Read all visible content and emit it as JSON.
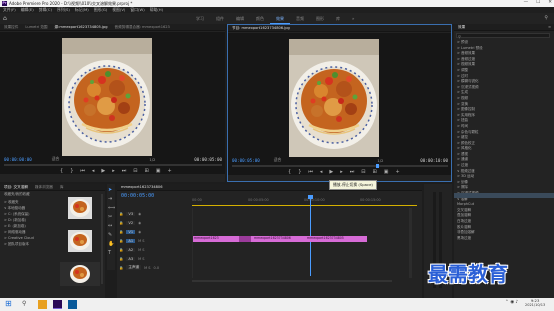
{
  "window": {
    "title": "Adobe Premiere Pro 2020 - D:\\\\视频\\\\010\\\\交叉溶解效果.prproj *",
    "minimize": "—",
    "maximize": "☐",
    "close": "✕"
  },
  "menu": [
    "文件(F)",
    "编辑(E)",
    "剪辑(C)",
    "序列(S)",
    "标记(M)",
    "图形(G)",
    "视图(V)",
    "窗口(W)",
    "帮助(H)"
  ],
  "workspaces": {
    "items": [
      "学习",
      "组件",
      "编辑",
      "颜色",
      "效果",
      "音频",
      "图形",
      "库"
    ],
    "active_index": 4,
    "overflow": "»"
  },
  "source_panel": {
    "tabs": [
      "效果控件",
      "Lumetri 范围",
      "源:mmexport1623734805.jpg",
      "音频剪辑混合器: mmexport1623"
    ],
    "active_tab_index": 2,
    "timecode_left": "00:00:00:00",
    "fit": "适合",
    "ratio": "1/2",
    "timecode_right": "00:00:05:00"
  },
  "program_panel": {
    "tabs": [
      "节目: mmexport1623734806.jpg"
    ],
    "timecode_left": "00:00:05:00",
    "fit": "适合",
    "ratio": "1/2",
    "timecode_right": "00:00:10:00"
  },
  "project_panel": {
    "tabs": [
      "项目: 交叉溶解",
      "媒体浏览器",
      "库",
      "信息",
      "效果"
    ],
    "active_tab_index": 0,
    "breadcrumb": "收藏夹/我的收藏",
    "tree": [
      "> 收藏夹",
      "∨ 本地驱动器",
      "> C: (系统保留)",
      "> D: (新加卷)",
      "> E: (新加卷)",
      "> 网络驱动器",
      "> Creative Cloud",
      "> 团队项目版本"
    ]
  },
  "timeline": {
    "tab": "mmexport1623734806",
    "timecode": "00:00:05:00",
    "tooltip": "播放-停止切换 (Space)",
    "ruler_labels": [
      "00:00",
      "00:00:05:00",
      "00:00:10:00",
      "00:00:15:00"
    ],
    "tracks": [
      "V3",
      "V2",
      "V1",
      "A1",
      "A2",
      "A3",
      "主声道"
    ],
    "master_value": "0.0",
    "clips": [
      {
        "label": "mmexport1623",
        "color": "#d66bd6"
      },
      {
        "label": "mmexport1623734806",
        "color": "#d66bd6"
      },
      {
        "label": "mmexport1623734805",
        "color": "#d66bd6"
      }
    ]
  },
  "effects_panel": {
    "title": "效果",
    "items": [
      "> 预设",
      "> Lumetri 预设",
      "> 音频效果",
      "> 音频过渡",
      "> 视频效果",
      "  > 调整",
      "  > 过时",
      "  > 模糊与锐化",
      "  > 沉浸式视频",
      "  > 生成",
      "  > 视频",
      "  > 变换",
      "  > 图像控制",
      "  > 实用程序",
      "  > 扭曲",
      "  > 时间",
      "  > 杂色与颗粒",
      "  > 键控",
      "  > 颜色校正",
      "  > 风格化",
      "  > 透视",
      "  > 通道",
      "  > 过渡",
      "∨ 视频过渡",
      "  > 3D 运动",
      "  > 划像",
      "  > 擦除",
      "  > 沉浸式视频",
      "  ∨ 溶解",
      "    MorphCut",
      "    交叉溶解",
      "    叠加溶解",
      "    白场过渡",
      "    胶片溶解",
      "    非叠加溶解",
      "    黑场过渡"
    ]
  },
  "watermark": "最需教育",
  "taskbar": {
    "time": "9:23",
    "date": "2021/10/13"
  }
}
